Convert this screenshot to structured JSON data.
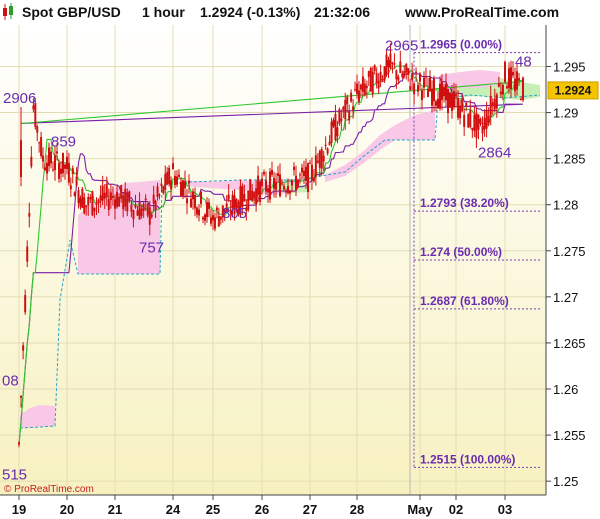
{
  "header": {
    "instrument": "Spot GBP/USD",
    "timeframe": "1 hour",
    "quote": "1.2924 (-0.13%)",
    "time": "21:32:06",
    "site": "www.ProRealTime.com"
  },
  "watermark": "© ProRealTime.com",
  "colors": {
    "background": "#fbf7d8",
    "candle": "#d01010",
    "tenkan_line": "#2ec82e",
    "kijun_line": "#7a1fa8",
    "cloud_fill": "#f8c8e6",
    "cloud_fill_bullish": "#c6efb5",
    "cloud_edge": "#29a3c7",
    "fib_line": "#7a3fb0",
    "price_badge": "#f5c400"
  },
  "chart_data": {
    "type": "candlestick",
    "instrument": "Spot GBP/USD",
    "timeframe": "1 hour",
    "last_price": 1.2924,
    "change_percent": -0.13,
    "y_axis": {
      "ylim": [
        1.2485,
        1.2995
      ],
      "ticks": [
        "1.295",
        "1.29",
        "1.285",
        "1.28",
        "1.275",
        "1.27",
        "1.265",
        "1.26",
        "1.255",
        "1.25"
      ]
    },
    "x_axis": {
      "ticks": [
        "19",
        "20",
        "21",
        "24",
        "25",
        "26",
        "27",
        "28",
        "May",
        "02",
        "03"
      ]
    },
    "price_path": [
      {
        "x": "19",
        "y": 1.254
      },
      {
        "x": "19.3",
        "y": 1.2906
      },
      {
        "x": "19.5",
        "y": 1.285
      },
      {
        "x": "20",
        "y": 1.284
      },
      {
        "x": "20.4",
        "y": 1.28
      },
      {
        "x": "21",
        "y": 1.281
      },
      {
        "x": "21.6",
        "y": 1.279
      },
      {
        "x": "24",
        "y": 1.2835
      },
      {
        "x": "25",
        "y": 1.2785
      },
      {
        "x": "26",
        "y": 1.282
      },
      {
        "x": "27",
        "y": 1.283
      },
      {
        "x": "27.5",
        "y": 1.288
      },
      {
        "x": "28",
        "y": 1.292
      },
      {
        "x": "28.5",
        "y": 1.295
      },
      {
        "x": "May",
        "y": 1.293
      },
      {
        "x": "02",
        "y": 1.291
      },
      {
        "x": "02.5",
        "y": 1.288
      },
      {
        "x": "03",
        "y": 1.294
      },
      {
        "x": "03.5",
        "y": 1.2924
      }
    ],
    "annotations": [
      {
        "label": "2906",
        "x": "19",
        "y": 1.2906
      },
      {
        "label": "859",
        "x": "20",
        "y": 1.2859
      },
      {
        "label": "757",
        "x": "21",
        "y": 1.2757
      },
      {
        "label": "805",
        "x": "26",
        "y": 1.2805
      },
      {
        "label": "2965",
        "x": "28",
        "y": 1.2965
      },
      {
        "label": "2864",
        "x": "02",
        "y": 1.2864
      },
      {
        "label": "48",
        "x": "03",
        "y": 1.2948
      },
      {
        "label": "08",
        "x": "19",
        "y": 1.2608
      },
      {
        "label": "515",
        "x": "19",
        "y": 1.2515
      }
    ],
    "fibonacci": [
      {
        "label": "1.2965 (0.00%)",
        "value": 1.2965
      },
      {
        "label": "1.2793 (38.20%)",
        "value": 1.2793
      },
      {
        "label": "1.274 (50.00%)",
        "value": 1.274
      },
      {
        "label": "1.2687 (61.80%)",
        "value": 1.2687
      },
      {
        "label": "1.2515 (100.00%)",
        "value": 1.2515
      }
    ],
    "last_price_label": "1.2924",
    "grid": true
  }
}
